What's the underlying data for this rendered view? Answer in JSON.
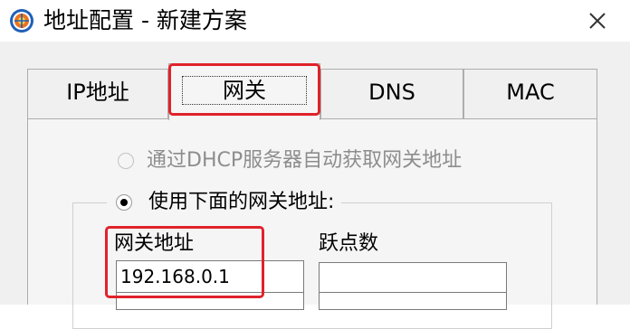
{
  "window": {
    "title": "地址配置 - 新建方案",
    "icon": "network-config-icon",
    "close_icon": "close-icon"
  },
  "tabs": [
    {
      "label": "IP地址",
      "active": false
    },
    {
      "label": "网关",
      "active": true
    },
    {
      "label": "DNS",
      "active": false
    },
    {
      "label": "MAC",
      "active": false
    }
  ],
  "gateway_page": {
    "auto_option": {
      "label": "通过DHCP服务器自动获取网关地址",
      "selected": false,
      "enabled": false
    },
    "manual_option": {
      "label": "使用下面的网关地址:",
      "selected": true,
      "enabled": true
    },
    "gateway_address": {
      "label": "网关地址",
      "value": "192.168.0.1"
    },
    "hop_count": {
      "label": "跃点数",
      "value": ""
    }
  },
  "colors": {
    "highlight": "#e0222b",
    "dialog_bg": "#f0f0f0"
  }
}
